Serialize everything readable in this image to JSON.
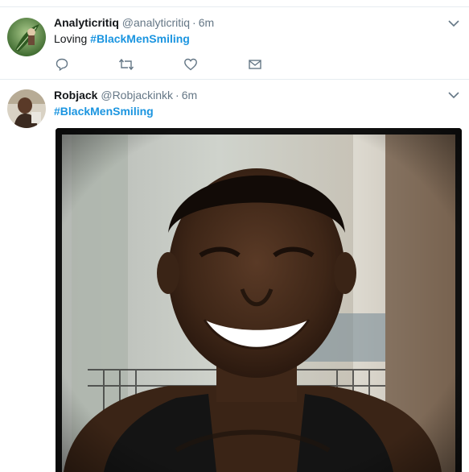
{
  "timeline": {
    "tweets": [
      {
        "name": "Analyticritiq",
        "handle": "@analyticritiq",
        "separator": "·",
        "time": "6m",
        "text_prefix": "Loving ",
        "hashtag": "#BlackMenSmiling",
        "avatar_icon": "leaf-avatar-icon",
        "actions": [
          {
            "name": "reply",
            "icon": "reply-icon"
          },
          {
            "name": "retweet",
            "icon": "retweet-icon"
          },
          {
            "name": "like",
            "icon": "heart-icon"
          },
          {
            "name": "message",
            "icon": "envelope-icon"
          }
        ]
      },
      {
        "name": "Robjack",
        "handle": "@Robjackinkk",
        "separator": "·",
        "time": "6m",
        "text_prefix": "",
        "hashtag": "#BlackMenSmiling",
        "avatar_icon": "person-avatar-icon",
        "media": {
          "kind": "photo",
          "subject": "selfie-photo"
        }
      }
    ]
  },
  "colors": {
    "link": "#1b95e0",
    "secondary_text": "#657786",
    "primary_text": "#14171a",
    "divider": "#e6ecf0"
  }
}
